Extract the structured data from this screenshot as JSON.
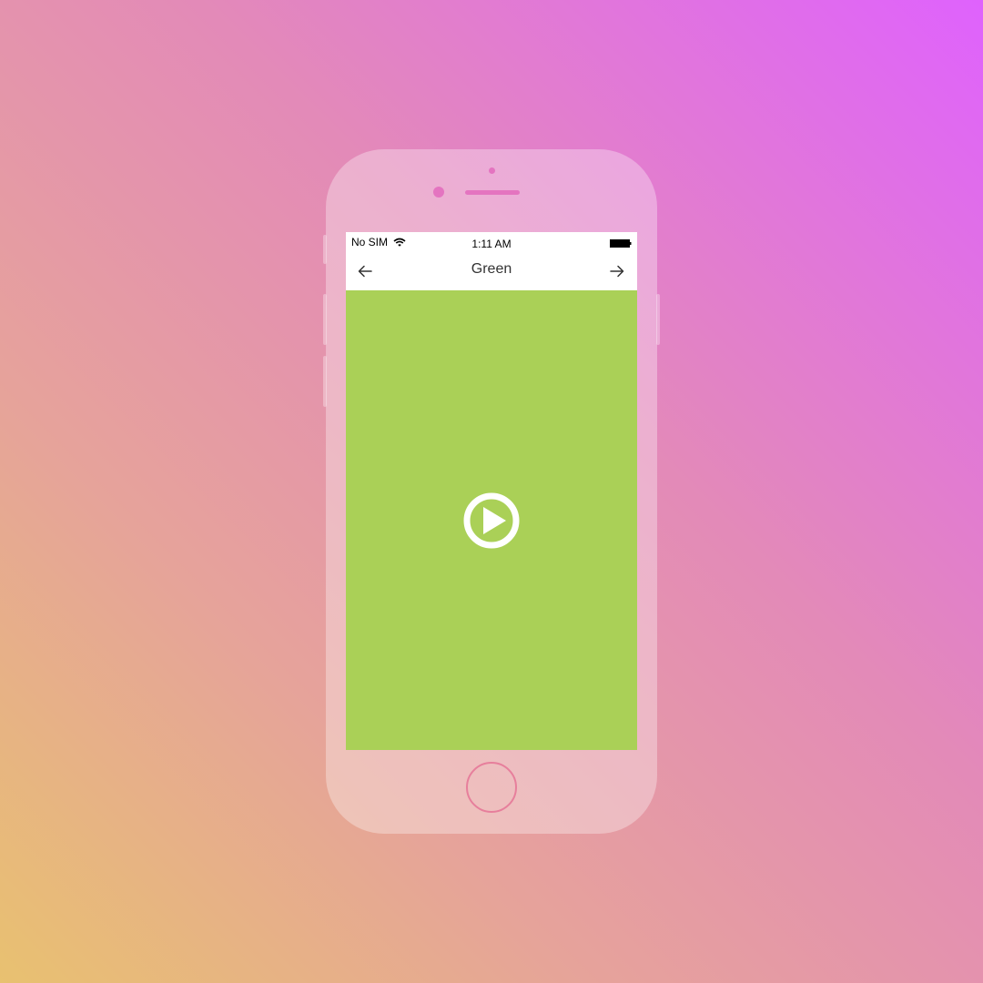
{
  "status_bar": {
    "carrier": "No SIM",
    "time": "1:11 AM",
    "wifi_icon": "wifi-icon",
    "battery_icon": "battery-full-icon"
  },
  "nav_bar": {
    "title": "Green",
    "back_icon": "arrow-left-icon",
    "forward_icon": "arrow-right-icon"
  },
  "content": {
    "background_color": "#aad057",
    "play_icon": "play-circle-icon"
  },
  "colors": {
    "accent_pink": "#e474c0",
    "home_ring": "#e77f9c",
    "play_white": "#ffffff"
  }
}
